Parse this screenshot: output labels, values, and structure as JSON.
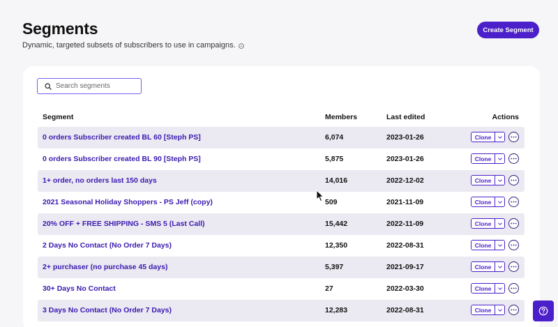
{
  "header": {
    "title": "Segments",
    "subtitle": "Dynamic, targeted subsets of subscribers to use in campaigns.",
    "create_button_label": "Create Segment"
  },
  "search": {
    "placeholder": "Search segments",
    "value": ""
  },
  "table": {
    "columns": {
      "segment": "Segment",
      "members": "Members",
      "last_edited": "Last edited",
      "actions": "Actions"
    },
    "clone_label": "Clone",
    "rows": [
      {
        "name": "0 orders Subscriber created BL 60 [Steph PS]",
        "members": "6,074",
        "last_edited": "2023-01-26"
      },
      {
        "name": "0 orders Subscriber created BL 90 [Steph PS]",
        "members": "5,875",
        "last_edited": "2023-01-26"
      },
      {
        "name": "1+ order, no orders last 150 days",
        "members": "14,016",
        "last_edited": "2022-12-02"
      },
      {
        "name": "2021 Seasonal Holiday Shoppers - PS Jeff (copy)",
        "members": "509",
        "last_edited": "2021-11-09"
      },
      {
        "name": "20% OFF + FREE SHIPPING - SMS 5 (Last Call)",
        "members": "15,442",
        "last_edited": "2022-11-09"
      },
      {
        "name": "2 Days No Contact (No Order 7 Days)",
        "members": "12,350",
        "last_edited": "2022-08-31"
      },
      {
        "name": "2+ purchaser (no purchase 45 days)",
        "members": "5,397",
        "last_edited": "2021-09-17"
      },
      {
        "name": "30+ Days No Contact",
        "members": "27",
        "last_edited": "2022-03-30"
      },
      {
        "name": "3 Days No Contact (No Order 7 Days)",
        "members": "12,283",
        "last_edited": "2022-08-31"
      }
    ]
  },
  "colors": {
    "accent": "#4b1fc9",
    "link": "#3a1ab0",
    "row_shade": "#ebe9f1",
    "background": "#f6f6f8"
  },
  "icons": [
    "info-icon",
    "search-icon",
    "chevron-down-icon",
    "more-options-icon",
    "mouse-cursor-icon",
    "help-icon"
  ]
}
